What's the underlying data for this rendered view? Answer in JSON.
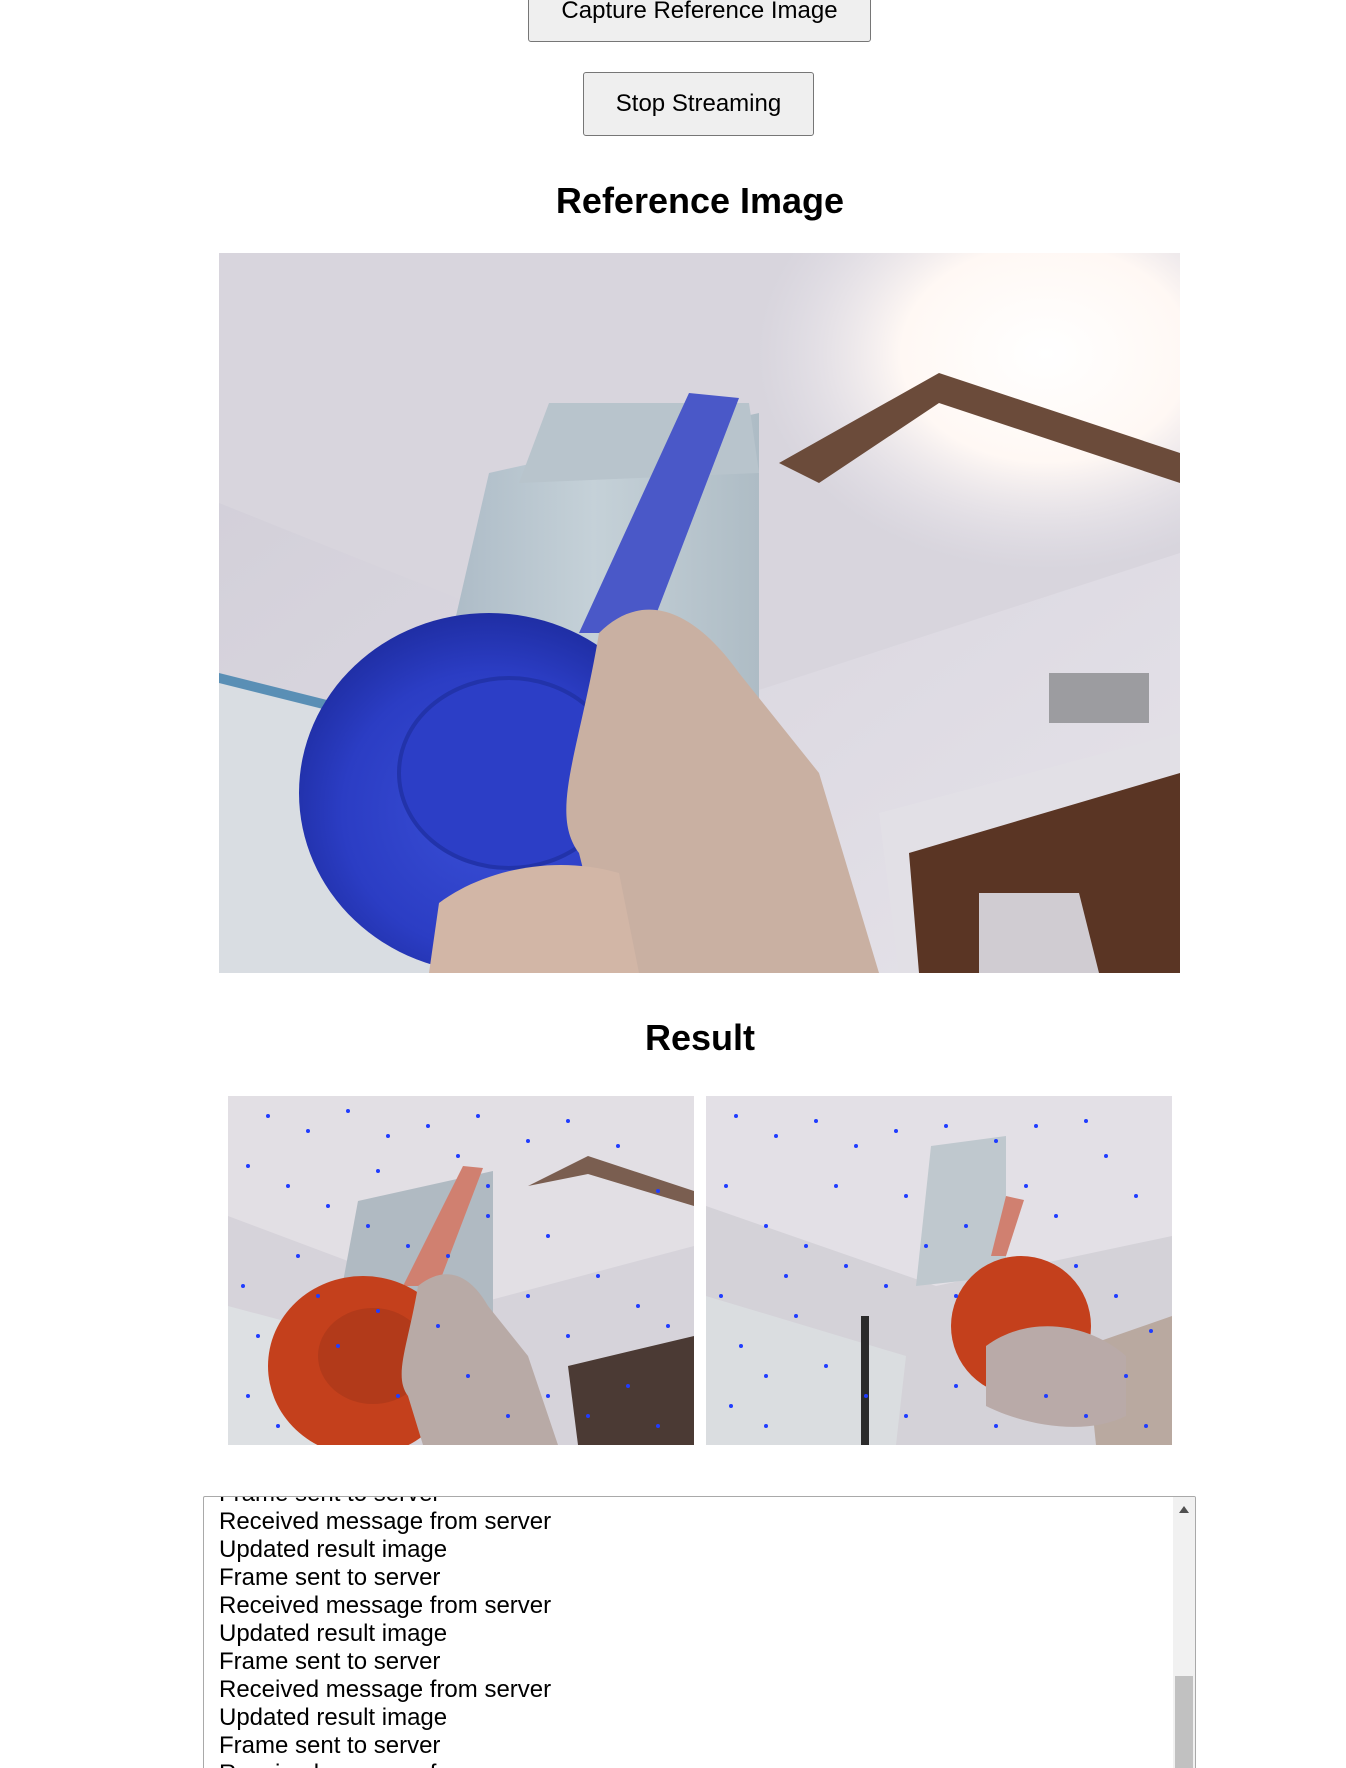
{
  "buttons": {
    "capture_label": "Capture Reference Image",
    "stop_label": "Stop Streaming"
  },
  "sections": {
    "reference_heading": "Reference Image",
    "result_heading": "Result"
  },
  "log": {
    "lines": [
      "Frame sent to server",
      "Received message from server",
      "Updated result image",
      "Frame sent to server",
      "Received message from server",
      "Updated result image",
      "Frame sent to server",
      "Received message from server",
      "Updated result image",
      "Frame sent to server",
      "Received message from server"
    ]
  },
  "colors": {
    "button_bg": "#efefef",
    "button_border": "#767676",
    "cap_blue": "#2f3fc8",
    "cap_orange": "#c0401e",
    "keypoint_blue": "#1f3cff"
  }
}
